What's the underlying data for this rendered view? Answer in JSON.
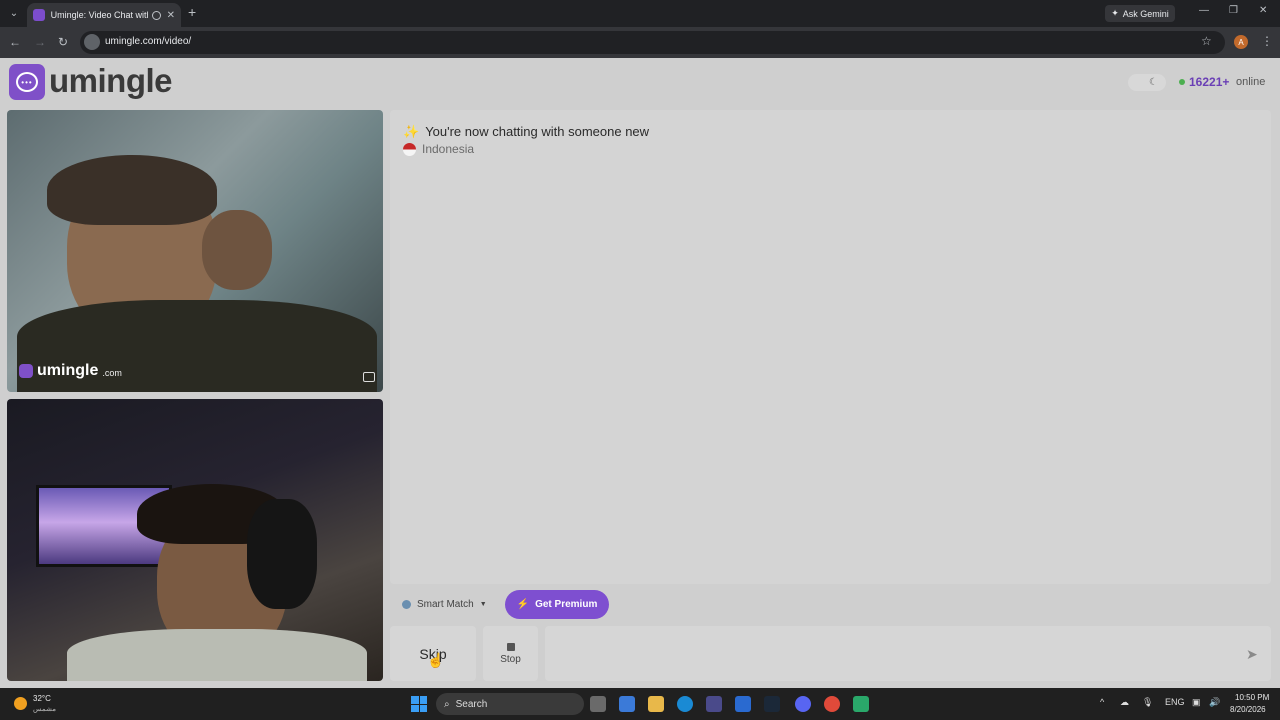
{
  "browser": {
    "tab_title": "Umingle: Video Chat with S",
    "tab_close": "✕",
    "new_tab": "+",
    "ask_gemini": "Ask Gemini",
    "url": "umingle.com/video/",
    "profile_initial": "A"
  },
  "site": {
    "logo_text": "umingle",
    "theme_icon": "moon-icon",
    "online_count": "16221+",
    "online_label": "online"
  },
  "videos": {
    "watermark_name": "umingle",
    "watermark_domain": ".com"
  },
  "chat": {
    "status_message": "You're now chatting with someone new",
    "country": "Indonesia",
    "mode_label": "Smart Match",
    "premium_label": "Get Premium",
    "skip_label": "Skip",
    "stop_label": "Stop",
    "message_placeholder": ""
  },
  "taskbar": {
    "weather_temp": "32°C",
    "weather_desc": "مشمس",
    "search_label": "Search",
    "language": "ENG",
    "time": "10:50 PM",
    "date": "8/20/2026"
  },
  "colors": {
    "brand": "#7f50c8",
    "online_dot": "#4caf50",
    "premium": "#7e4fd0"
  }
}
